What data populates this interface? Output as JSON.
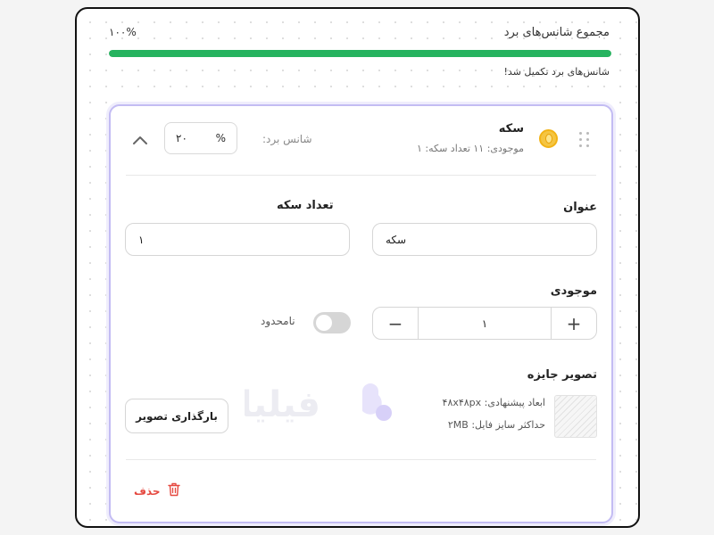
{
  "progress": {
    "total_label": "مجموع شانس‌های برد",
    "total_value": "۱۰۰%",
    "percent": 100,
    "complete_message": "شانس‌های برد تکمیل شد!",
    "bar_color": "#26b35f"
  },
  "item": {
    "title": "سکه",
    "subtitle": "موجودی: ۱۱ تعداد سکه: ۱",
    "chance_label": "شانس برد:",
    "chance_value": "۲۰",
    "chance_unit": "%",
    "icon": "coin-icon",
    "collapse_icon": "chevron-up-icon",
    "drag_icon": "drag-handle-icon"
  },
  "form": {
    "title_label": "عنوان",
    "title_value": "سکه",
    "coin_count_label": "تعداد سکه",
    "coin_count_value": "۱",
    "stock_label": "موجودی",
    "stock_value": "۱",
    "stock_plus": "+",
    "stock_minus": "−",
    "unlimited_label": "نامحدود",
    "unlimited_on": false,
    "image_label": "تصویر جایزه",
    "image_hint_size": "ابعاد پیشنهادی: ۴۸x۴۸px",
    "image_hint_max": "حداکثر سایز فایل: ۲MB",
    "upload_label": "بارگذاری تصویر",
    "watermark_text": "فیلیا",
    "delete_label": "حذف"
  },
  "colors": {
    "accent_border": "#c3bcf3",
    "danger": "#e5483f",
    "coin": "#f5c542"
  }
}
